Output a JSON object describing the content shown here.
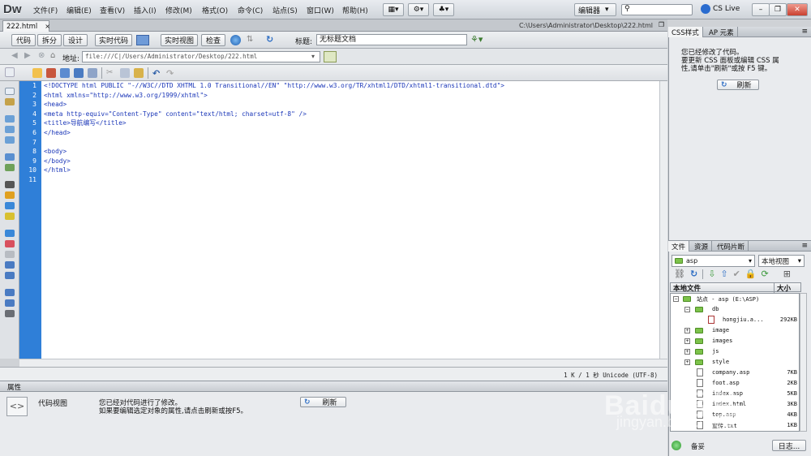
{
  "app": {
    "logo": "Dw"
  },
  "menus": [
    "文件(F)",
    "编辑(E)",
    "查看(V)",
    "插入(I)",
    "修改(M)",
    "格式(O)",
    "命令(C)",
    "站点(S)",
    "窗口(W)",
    "帮助(H)"
  ],
  "topbar": {
    "workspace": "编辑器",
    "cslive": "CS Live",
    "search_placeholder": ""
  },
  "document": {
    "tab": "222.html",
    "path": "C:\\Users\\Administrator\\Desktop\\222.html"
  },
  "viewbar": {
    "code": "代码",
    "split": "拆分",
    "design": "设计",
    "live_code": "实时代码",
    "live_view": "实时视图",
    "inspect": "检查",
    "title_label": "标题:",
    "title_value": "无标题文档"
  },
  "addressbar": {
    "label": "地址:",
    "value": "file:///C|/Users/Administrator/Desktop/222.html"
  },
  "code": {
    "line_numbers": [
      "1",
      "2",
      "3",
      "4",
      "5",
      "6",
      "7",
      "8",
      "9",
      "10",
      "11"
    ],
    "lines": [
      "<!DOCTYPE html PUBLIC \"-//W3C//DTD XHTML 1.0 Transitional//EN\" \"http://www.w3.org/TR/xhtml1/DTD/xhtml1-transitional.dtd\">",
      "<html xmlns=\"http://www.w3.org/1999/xhtml\">",
      "<head>",
      "<meta http-equiv=\"Content-Type\" content=\"text/html; charset=utf-8\" />",
      "<title>导航编写</title>",
      "</head>",
      "",
      "<body>",
      "</body>",
      "</html>",
      ""
    ]
  },
  "status": {
    "text": "1 K / 1 秒  Unicode (UTF-8)"
  },
  "properties": {
    "header": "属性",
    "mode": "代码视图",
    "message1": "您已经对代码进行了修改。",
    "message2": "如果要编辑选定对象的属性,请点击刷新或按F5。",
    "refresh": "刷新"
  },
  "css_panel": {
    "tab_css": "CSS样式",
    "tab_ap": "AP 元素",
    "message1": "您已经修改了代码。",
    "message2": "要更新 CSS 面板或编辑 CSS 属",
    "message3": "性,请单击\"刷新\"或按 F5 键。",
    "refresh": "刷新"
  },
  "files_panel": {
    "tab_files": "文件",
    "tab_assets": "资源",
    "tab_snippets": "代码片断",
    "site_select": "asp",
    "view_select": "本地视图",
    "col_name": "本地文件",
    "col_size": "大小",
    "items": [
      {
        "name": "站点 - asp (E:\\ASP)",
        "size": "",
        "kind": "site",
        "level": 0
      },
      {
        "name": "db",
        "size": "",
        "kind": "folder",
        "level": 1
      },
      {
        "name": "hongjiu.a...",
        "size": "292KB",
        "kind": "file",
        "level": 2
      },
      {
        "name": "image",
        "size": "",
        "kind": "folder",
        "level": 1
      },
      {
        "name": "images",
        "size": "",
        "kind": "folder",
        "level": 1
      },
      {
        "name": "js",
        "size": "",
        "kind": "folder",
        "level": 1
      },
      {
        "name": "style",
        "size": "",
        "kind": "folder",
        "level": 1
      },
      {
        "name": "company.asp",
        "size": "7KB",
        "kind": "file",
        "level": 1
      },
      {
        "name": "foot.asp",
        "size": "2KB",
        "kind": "file",
        "level": 1
      },
      {
        "name": "index.asp",
        "size": "5KB",
        "kind": "file",
        "level": 1
      },
      {
        "name": "index.html",
        "size": "3KB",
        "kind": "file",
        "level": 1
      },
      {
        "name": "top.asp",
        "size": "4KB",
        "kind": "file",
        "level": 1
      },
      {
        "name": "宣传.txt",
        "size": "1KB",
        "kind": "file",
        "level": 1
      }
    ],
    "footer_label": "备妥",
    "log_button": "日志..."
  },
  "watermark": {
    "text": "Baidu经验",
    "sub": "jingyan.baidu.com"
  }
}
